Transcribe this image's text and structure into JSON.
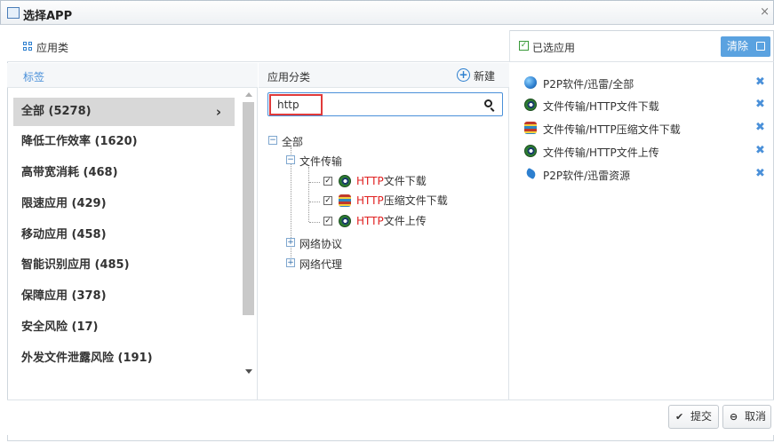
{
  "window": {
    "title": "选择APP",
    "close": "×"
  },
  "header": {
    "left_label": "应用类",
    "right_label": "已选应用",
    "clear_label": "清除"
  },
  "categories": {
    "header": "标签",
    "items": [
      {
        "label": "全部 (5278)",
        "active": true
      },
      {
        "label": "降低工作效率 (1620)"
      },
      {
        "label": "高带宽消耗 (468)"
      },
      {
        "label": "限速应用 (429)"
      },
      {
        "label": "移动应用 (458)"
      },
      {
        "label": "智能识别应用 (485)"
      },
      {
        "label": "保障应用 (378)"
      },
      {
        "label": "安全风险 (17)"
      },
      {
        "label": "外发文件泄露风险 (191)"
      }
    ],
    "chevron": "›"
  },
  "app_tree": {
    "header": "应用分类",
    "new_label": "新建",
    "search_value": "http",
    "root": "全部",
    "groups": [
      {
        "label": "文件传输",
        "children": [
          {
            "highlight": "HTTP",
            "rest": "文件下载",
            "icon": "eye"
          },
          {
            "highlight": "HTTP",
            "rest": "压缩文件下载",
            "icon": "stack"
          },
          {
            "highlight": "HTTP",
            "rest": "文件上传",
            "icon": "eye"
          }
        ]
      },
      {
        "label": "网络协议"
      },
      {
        "label": "网络代理"
      }
    ]
  },
  "selected": [
    {
      "name": "P2P软件/迅雷/全部",
      "icon": "globe"
    },
    {
      "name": "文件传输/HTTP文件下载",
      "icon": "eye"
    },
    {
      "name": "文件传输/HTTP压缩文件下载",
      "icon": "stack"
    },
    {
      "name": "文件传输/HTTP文件上传",
      "icon": "eye"
    },
    {
      "name": "P2P软件/迅雷资源",
      "icon": "bird"
    }
  ],
  "footer": {
    "submit": "提交",
    "cancel": "取消"
  },
  "colors": {
    "accent": "#4a90d9",
    "highlight": "#e02020",
    "clear_button": "#5aa2e0"
  }
}
